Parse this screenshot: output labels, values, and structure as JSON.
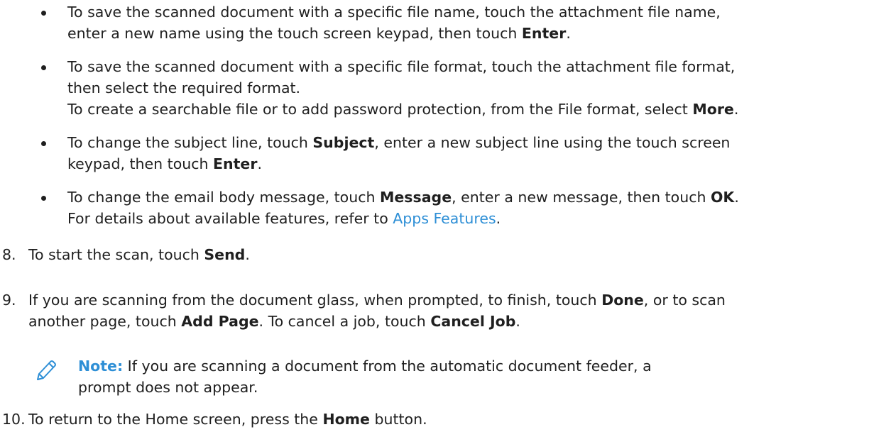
{
  "bullets": [
    {
      "line1_a": "To save the scanned document with a specific file name, touch the attachment file name,",
      "line2_a": "enter a new name using the touch screen keypad, then touch ",
      "line2_b": "Enter",
      "line2_c": "."
    },
    {
      "line1_a": "To save the scanned document with a specific file format, touch the attachment file format,",
      "line2_a": "then select the required format.",
      "line3_a": "To create a searchable file or to add password protection, from the File format, select ",
      "line3_b": "More",
      "line3_c": "."
    },
    {
      "line1_a": "To change the subject line, touch ",
      "line1_b": "Subject",
      "line1_c": ", enter a new subject line using the touch screen",
      "line2_a": "keypad, then touch ",
      "line2_b": "Enter",
      "line2_c": "."
    },
    {
      "line1_a": "To change the email body message, touch ",
      "line1_b": "Message",
      "line1_c": ", enter a new message, then touch ",
      "line1_d": "OK",
      "line1_e": ".",
      "line2_a": "For details about available features, refer to ",
      "line2_link": "Apps Features",
      "line2_c": "."
    }
  ],
  "steps": [
    {
      "number": "8.",
      "a": "To start the scan, touch ",
      "b": "Send",
      "c": "."
    },
    {
      "number": "9.",
      "line1_a": "If you are scanning from the document glass, when prompted, to finish, touch ",
      "line1_b": "Done",
      "line1_c": ", or to scan",
      "line2_a": "another page, touch ",
      "line2_b": "Add Page",
      "line2_c": ". To cancel a job, touch ",
      "line2_d": "Cancel Job",
      "line2_e": "."
    },
    {
      "number": "10.",
      "a": "To return to the Home screen, press the ",
      "b": "Home",
      "c": " button."
    }
  ],
  "note": {
    "label": "Note:",
    "line1": " If you are scanning a document from the automatic document feeder, a",
    "line2": "prompt does not appear.",
    "icon": "pencil-icon"
  },
  "colors": {
    "text": "#1f1f1f",
    "accent": "#2e8fd6"
  }
}
